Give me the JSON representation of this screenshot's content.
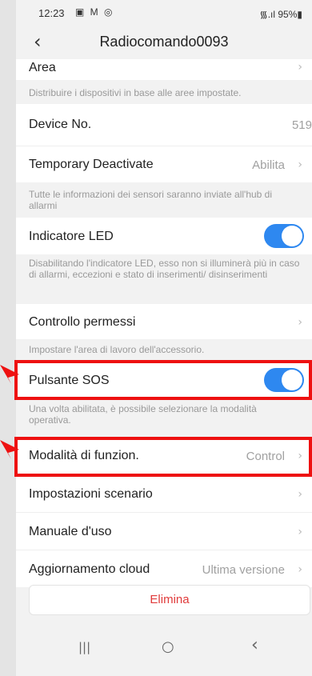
{
  "status_bar": {
    "time": "12:23",
    "notif_icons": "▣ M ◎",
    "signal_battery": "᯾.ıl 95%▮"
  },
  "header": {
    "back_glyph": "‹",
    "title": "Radiocomando0093"
  },
  "area": {
    "label": "Area",
    "hint": "Distribuire i dispositivi in base alle aree impostate."
  },
  "device_no": {
    "label": "Device No.",
    "value": "519"
  },
  "temporary_deactivate": {
    "label": "Temporary Deactivate",
    "value": "Abilita",
    "hint": "Tutte le informazioni dei sensori saranno inviate all'hub di allarmi"
  },
  "led": {
    "label": "Indicatore LED",
    "enabled": true,
    "hint": "Disabilitando l'indicatore LED, esso non si illuminerà più in caso di allarmi, eccezioni e stato di inserimenti/ disinserimenti"
  },
  "permissions": {
    "label": "Controllo permessi",
    "hint": "Impostare l'area di lavoro dell'accessorio."
  },
  "sos": {
    "label": "Pulsante SOS",
    "enabled": true,
    "hint": "Una volta abilitata, è possibile selezionare la modalità operativa."
  },
  "mode": {
    "label": "Modalità di funzion.",
    "value": "Control"
  },
  "scene": {
    "label": "Impostazioni scenario"
  },
  "manual": {
    "label": "Manuale d'uso"
  },
  "cloud": {
    "label": "Aggiornamento cloud",
    "value": "Ultima versione"
  },
  "delete_label": "Elimina",
  "chevron": "›",
  "nav": {
    "recent": "|||",
    "home": "○",
    "back": "‹"
  },
  "colors": {
    "accent": "#2e88f0",
    "annotation": "#ee1111",
    "danger": "#e03a3a"
  }
}
